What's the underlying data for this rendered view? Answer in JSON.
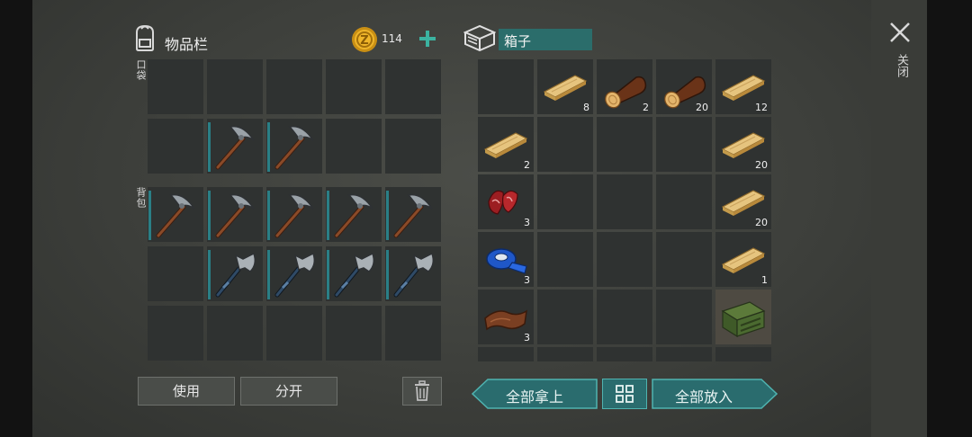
{
  "inventory": {
    "title": "物品栏",
    "coins": "114",
    "pocket_label": "口袋",
    "backpack_label": "背包"
  },
  "box": {
    "title": "箱子"
  },
  "close": {
    "label": "关闭"
  },
  "buttons": {
    "use": "使用",
    "split": "分开",
    "take_all": "全部拿上",
    "put_all": "全部放入"
  },
  "left_items": {
    "pocket_row2": [
      "",
      "pickaxe",
      "pickaxe",
      "",
      ""
    ],
    "backpack_row1": [
      "pickaxe",
      "pickaxe",
      "pickaxe",
      "pickaxe",
      "pickaxe"
    ],
    "backpack_row2": [
      "",
      "axe",
      "axe",
      "axe",
      "axe"
    ]
  },
  "box_items": [
    {
      "name": "wood-plank",
      "count": "8"
    },
    {
      "name": "log",
      "count": "2"
    },
    {
      "name": "log",
      "count": "20"
    },
    {
      "name": "wood-plank",
      "count": "12"
    },
    {
      "name": "wood-plank",
      "count": "2"
    },
    {
      "name": "wood-plank",
      "count": "20"
    },
    {
      "name": "raw-meat",
      "count": "3"
    },
    {
      "name": "wood-plank",
      "count": "20"
    },
    {
      "name": "duct-tape",
      "count": "3"
    },
    {
      "name": "wood-plank",
      "count": "1"
    },
    {
      "name": "leather",
      "count": "3"
    },
    {
      "name": "ammo-crate",
      "count": ""
    }
  ]
}
